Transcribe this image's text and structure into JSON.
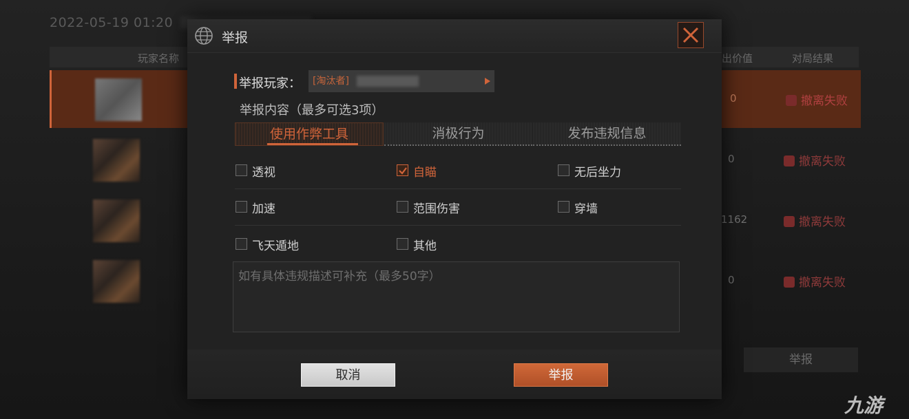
{
  "background": {
    "date": "2022-05-19 01:20",
    "table_headers": [
      "玩家名称",
      "出价值",
      "对局结果"
    ],
    "rows": [
      {
        "value": "0",
        "result": "撤离失败"
      },
      {
        "value": "0",
        "result": "撤离失败"
      },
      {
        "value": "1162",
        "result": "撤离失败"
      },
      {
        "value": "0",
        "result": "撤离失败"
      }
    ],
    "report_button": "举报"
  },
  "dialog": {
    "title": "举报",
    "target_label": "举报玩家：",
    "target_value": "[淘汰者]",
    "content_label": "举报内容（最多可选3项）",
    "tabs": [
      {
        "label": "使用作弊工具",
        "active": true
      },
      {
        "label": "消极行为",
        "active": false
      },
      {
        "label": "发布违规信息",
        "active": false
      }
    ],
    "options": [
      {
        "label": "透视",
        "checked": false
      },
      {
        "label": "自瞄",
        "checked": true
      },
      {
        "label": "无后坐力",
        "checked": false
      },
      {
        "label": "加速",
        "checked": false
      },
      {
        "label": "范围伤害",
        "checked": false
      },
      {
        "label": "穿墙",
        "checked": false
      },
      {
        "label": "飞天遁地",
        "checked": false
      },
      {
        "label": "其他",
        "checked": false
      }
    ],
    "description_placeholder": "如有具体违规描述可补充（最多50字）",
    "cancel_label": "取消",
    "submit_label": "举报"
  },
  "watermark": "九游",
  "colors": {
    "accent": "#d0643a",
    "panel": "#222222",
    "fail_red": "#8e3a3a"
  }
}
